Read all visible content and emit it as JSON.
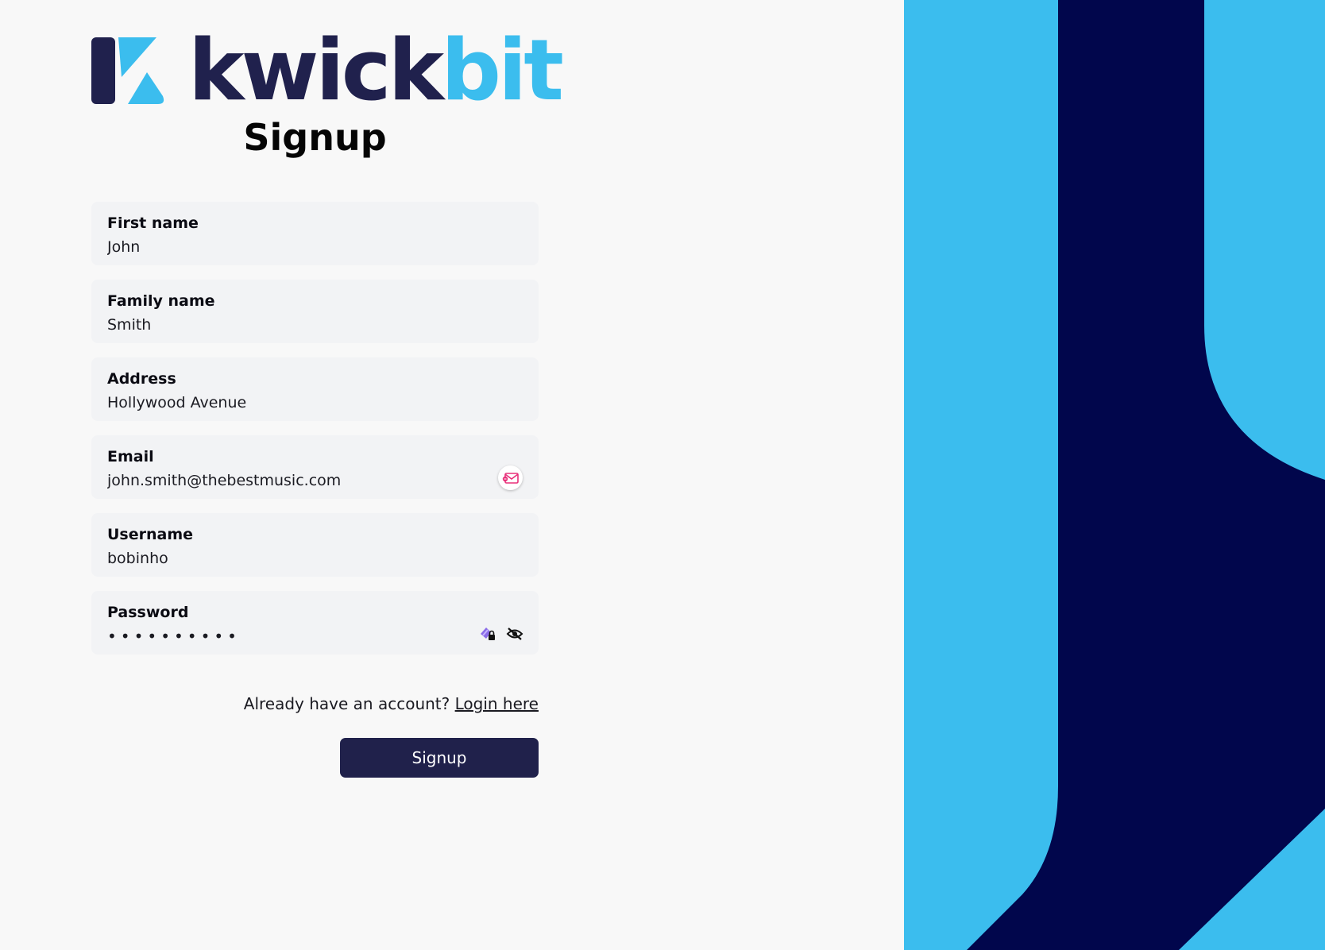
{
  "brand": {
    "name_part1": "kwick",
    "name_part2": "bit",
    "primary_color": "#20214d",
    "accent_color": "#3bbdee"
  },
  "page": {
    "title": "Signup"
  },
  "form": {
    "first_name": {
      "label": "First name",
      "value": "John"
    },
    "family_name": {
      "label": "Family name",
      "value": "Smith"
    },
    "address": {
      "label": "Address",
      "value": "Hollywood Avenue"
    },
    "email": {
      "label": "Email",
      "value": "john.smith@thebestmusic.com",
      "icon": "mail-alert-icon"
    },
    "username": {
      "label": "Username",
      "value": "bobinho"
    },
    "password": {
      "label": "Password",
      "value": "••••••••••",
      "icons": [
        "password-manager-icon",
        "eye-off-icon"
      ]
    }
  },
  "footer": {
    "account_prompt": "Already have an account?",
    "login_link": "Login here",
    "signup_button": "Signup"
  },
  "decor": {
    "light_blue": "#3bbdee",
    "navy": "#01064c"
  }
}
